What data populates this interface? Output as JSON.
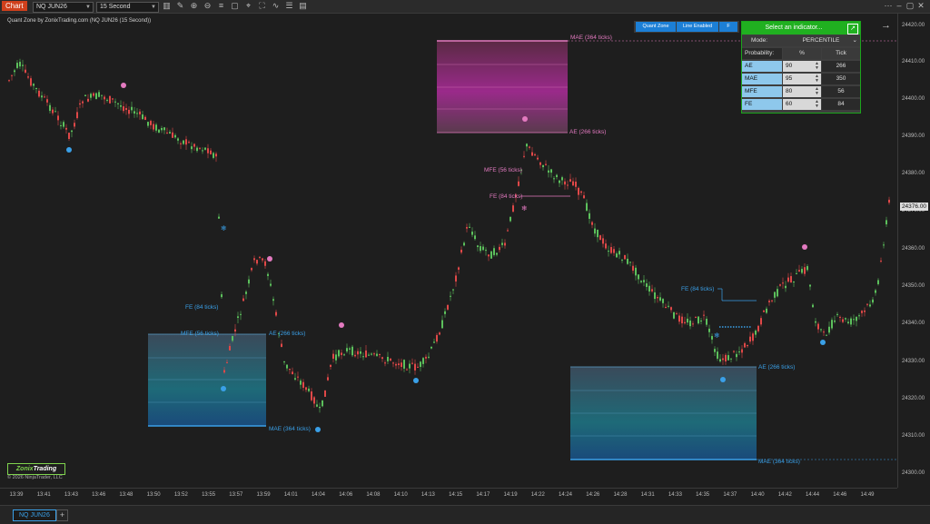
{
  "toolbar": {
    "chart_button": "Chart",
    "instrument": "NQ JUN26",
    "interval": "15 Second",
    "icons": [
      "bar-style-icon",
      "draw-icon",
      "zoom-in-icon",
      "zoom-out-icon",
      "text-icon",
      "screenshot-icon",
      "crosshair-icon",
      "strategies-icon",
      "indicators-icon",
      "properties-icon",
      "data-icon"
    ]
  },
  "chart_title": "Quant Zone by ZonixTrading.com (NQ JUN26 (15 Second))",
  "quant_buttons": {
    "quant_zone": "Quant Zone",
    "line_enabled": "Line Enabled",
    "f": "F"
  },
  "indicator_panel": {
    "header": "Select an indicator...",
    "mode_label": "Mode:",
    "mode_value": "PERCENTILE",
    "probability_label": "Probability:",
    "pct_header": "%",
    "tick_header": "Tick",
    "rows": [
      {
        "name": "AE",
        "pct": "90",
        "tick": "266"
      },
      {
        "name": "MAE",
        "pct": "95",
        "tick": "350"
      },
      {
        "name": "MFE",
        "pct": "80",
        "tick": "56"
      },
      {
        "name": "FE",
        "pct": "60",
        "tick": "84"
      }
    ]
  },
  "y_axis": {
    "labels": [
      "24420.00",
      "24410.00",
      "24400.00",
      "24390.00",
      "24380.00",
      "24370.00",
      "24360.00",
      "24350.00",
      "24340.00",
      "24330.00",
      "24320.00",
      "24310.00",
      "24300.00"
    ],
    "current": "24376.00"
  },
  "x_axis": {
    "labels": [
      "13:39",
      "13:41",
      "13:43",
      "13:46",
      "13:48",
      "13:50",
      "13:52",
      "13:55",
      "13:57",
      "13:59",
      "14:01",
      "14:04",
      "14:06",
      "14:08",
      "14:10",
      "14:13",
      "14:15",
      "14:17",
      "14:19",
      "14:22",
      "14:24",
      "14:26",
      "14:28",
      "14:31",
      "14:33",
      "14:35",
      "14:37",
      "14:40",
      "14:42",
      "14:44",
      "14:46",
      "14:49"
    ]
  },
  "levels": {
    "mae_364_top": "MAE (364 ticks)",
    "ae_266_top": "AE (266 ticks)",
    "mfe_56_top": "MFE (56 ticks)",
    "fe_84_top": "FE (84 ticks)",
    "fe_84_left": "FE (84 ticks)",
    "mfe_56_left": "MFE (56 ticks)",
    "ae_266_left": "AE (266 ticks)",
    "mae_364_left": "MAE (364 ticks)",
    "fe_84_right": "FE (84 ticks)",
    "ae_266_right": "AE (266 ticks)",
    "mae_364_right": "MAE (364 ticks)"
  },
  "logo": {
    "part1": "Zonix",
    "part2": "Trading"
  },
  "copyright": "© 2026 NinjaTrader, LLC",
  "bottom_tab": "NQ JUN26",
  "add_tab": "+",
  "colors": {
    "up": "#5cc05c",
    "down": "#e04848",
    "pink": "#e37ac0",
    "blue": "#3aa0e8",
    "green_panel": "#20b020"
  }
}
